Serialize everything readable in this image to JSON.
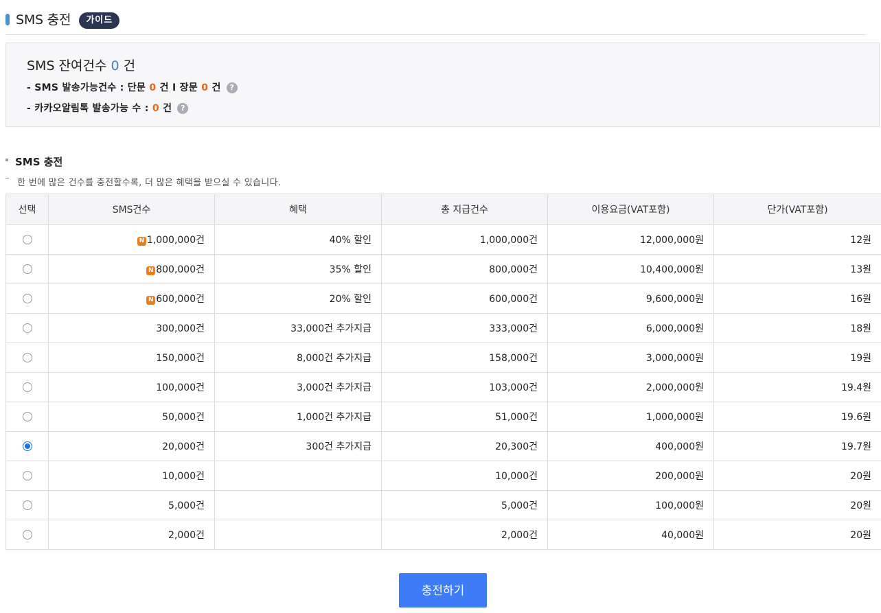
{
  "header": {
    "title": "SMS 충전",
    "guide_label": "가이드"
  },
  "summary": {
    "remain_label": "SMS 잔여건수",
    "remain_count": "0",
    "remain_unit": "건",
    "sendable_prefix": "- SMS 발송가능건수 : 단문",
    "short_count": "0",
    "short_unit": "건",
    "separator": "I",
    "long_label": "장문",
    "long_count": "0",
    "long_unit": "건",
    "kakao_prefix": "- 카카오알림톡 발송가능 수 :",
    "kakao_count": "0",
    "kakao_unit": "건",
    "help_glyph": "?"
  },
  "charge_section": {
    "title": "SMS 충전",
    "description": "한 번에 많은 건수를 충전할수록, 더 많은 혜택을 받으실 수 있습니다."
  },
  "table": {
    "columns": [
      "선택",
      "SMS건수",
      "혜택",
      "총 지급건수",
      "이용요금(VAT포함)",
      "단가(VAT포함)"
    ],
    "badge_label": "N",
    "rows": [
      {
        "selected": false,
        "badge": true,
        "count": "1,000,000건",
        "benefit": "40% 할인",
        "total": "1,000,000건",
        "price": "12,000,000원",
        "unit_price": "12원"
      },
      {
        "selected": false,
        "badge": true,
        "count": "800,000건",
        "benefit": "35% 할인",
        "total": "800,000건",
        "price": "10,400,000원",
        "unit_price": "13원"
      },
      {
        "selected": false,
        "badge": true,
        "count": "600,000건",
        "benefit": "20% 할인",
        "total": "600,000건",
        "price": "9,600,000원",
        "unit_price": "16원"
      },
      {
        "selected": false,
        "badge": false,
        "count": "300,000건",
        "benefit": "33,000건 추가지급",
        "total": "333,000건",
        "price": "6,000,000원",
        "unit_price": "18원"
      },
      {
        "selected": false,
        "badge": false,
        "count": "150,000건",
        "benefit": "8,000건 추가지급",
        "total": "158,000건",
        "price": "3,000,000원",
        "unit_price": "19원"
      },
      {
        "selected": false,
        "badge": false,
        "count": "100,000건",
        "benefit": "3,000건 추가지급",
        "total": "103,000건",
        "price": "2,000,000원",
        "unit_price": "19.4원"
      },
      {
        "selected": false,
        "badge": false,
        "count": "50,000건",
        "benefit": "1,000건 추가지급",
        "total": "51,000건",
        "price": "1,000,000원",
        "unit_price": "19.6원"
      },
      {
        "selected": true,
        "badge": false,
        "count": "20,000건",
        "benefit": "300건 추가지급",
        "total": "20,300건",
        "price": "400,000원",
        "unit_price": "19.7원"
      },
      {
        "selected": false,
        "badge": false,
        "count": "10,000건",
        "benefit": "",
        "total": "10,000건",
        "price": "200,000원",
        "unit_price": "20원"
      },
      {
        "selected": false,
        "badge": false,
        "count": "5,000건",
        "benefit": "",
        "total": "5,000건",
        "price": "100,000원",
        "unit_price": "20원"
      },
      {
        "selected": false,
        "badge": false,
        "count": "2,000건",
        "benefit": "",
        "total": "2,000건",
        "price": "40,000원",
        "unit_price": "20원"
      }
    ]
  },
  "charge_button_label": "충전하기",
  "colors": {
    "accent_blue": "#3e7bf6",
    "count_blue": "#3d7fd1",
    "benefit_orange": "#e06a1e",
    "badge_orange": "#ef7d1a",
    "guide_dark": "#2a3550"
  }
}
